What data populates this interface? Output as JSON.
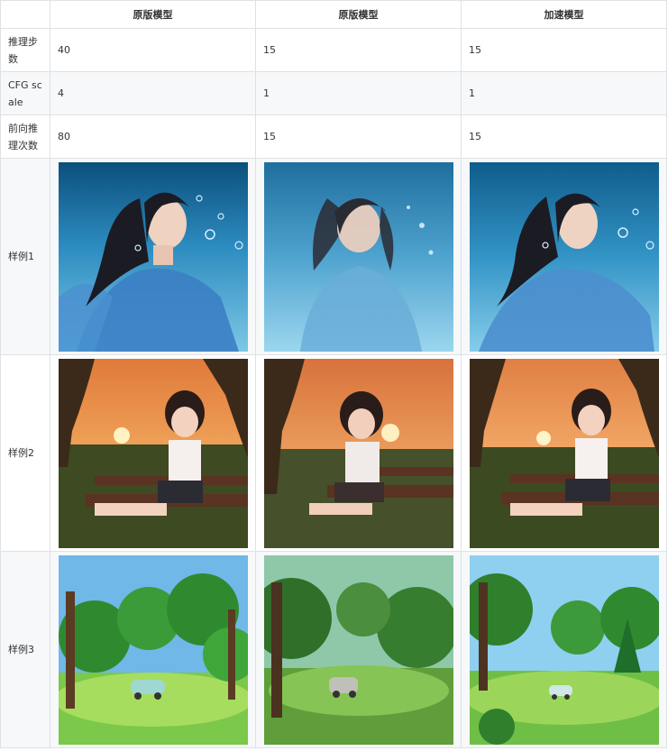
{
  "header": [
    "",
    "原版模型",
    "原版模型",
    "加速模型"
  ],
  "rows": [
    {
      "label": "推理步数",
      "values": [
        "40",
        "15",
        "15"
      ]
    },
    {
      "label": "CFG scale",
      "values": [
        "4",
        "1",
        "1"
      ]
    },
    {
      "label": "前向推理次数",
      "values": [
        "80",
        "15",
        "15"
      ]
    }
  ],
  "samples": [
    {
      "label": "样例1",
      "theme": "underwater-girl"
    },
    {
      "label": "样例2",
      "theme": "sunset-bench-girl"
    },
    {
      "label": "样例3",
      "theme": "forest-meadow-car"
    }
  ],
  "colors": {
    "border": "#dfe2e5",
    "zebra": "#f6f8fa",
    "text": "#333333"
  }
}
